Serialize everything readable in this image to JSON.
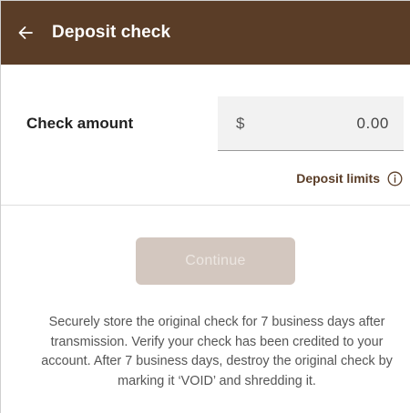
{
  "header": {
    "back_icon": "arrow-left-icon",
    "title": "Deposit check"
  },
  "amount": {
    "label": "Check amount",
    "currency_symbol": "$",
    "value": "0.00"
  },
  "limits": {
    "label": "Deposit limits",
    "icon": "info-icon"
  },
  "actions": {
    "continue_label": "Continue",
    "continue_enabled": false
  },
  "note": {
    "text": "Securely store the original check for 7 business days after transmission. Verify your check has been credited to your account. After 7 business days, destroy the original check by marking it ‘VOID’ and shredding it."
  },
  "colors": {
    "header_bg": "#5a3d27",
    "accent_text": "#5a3d27",
    "button_disabled_bg": "#d3c7bf"
  }
}
